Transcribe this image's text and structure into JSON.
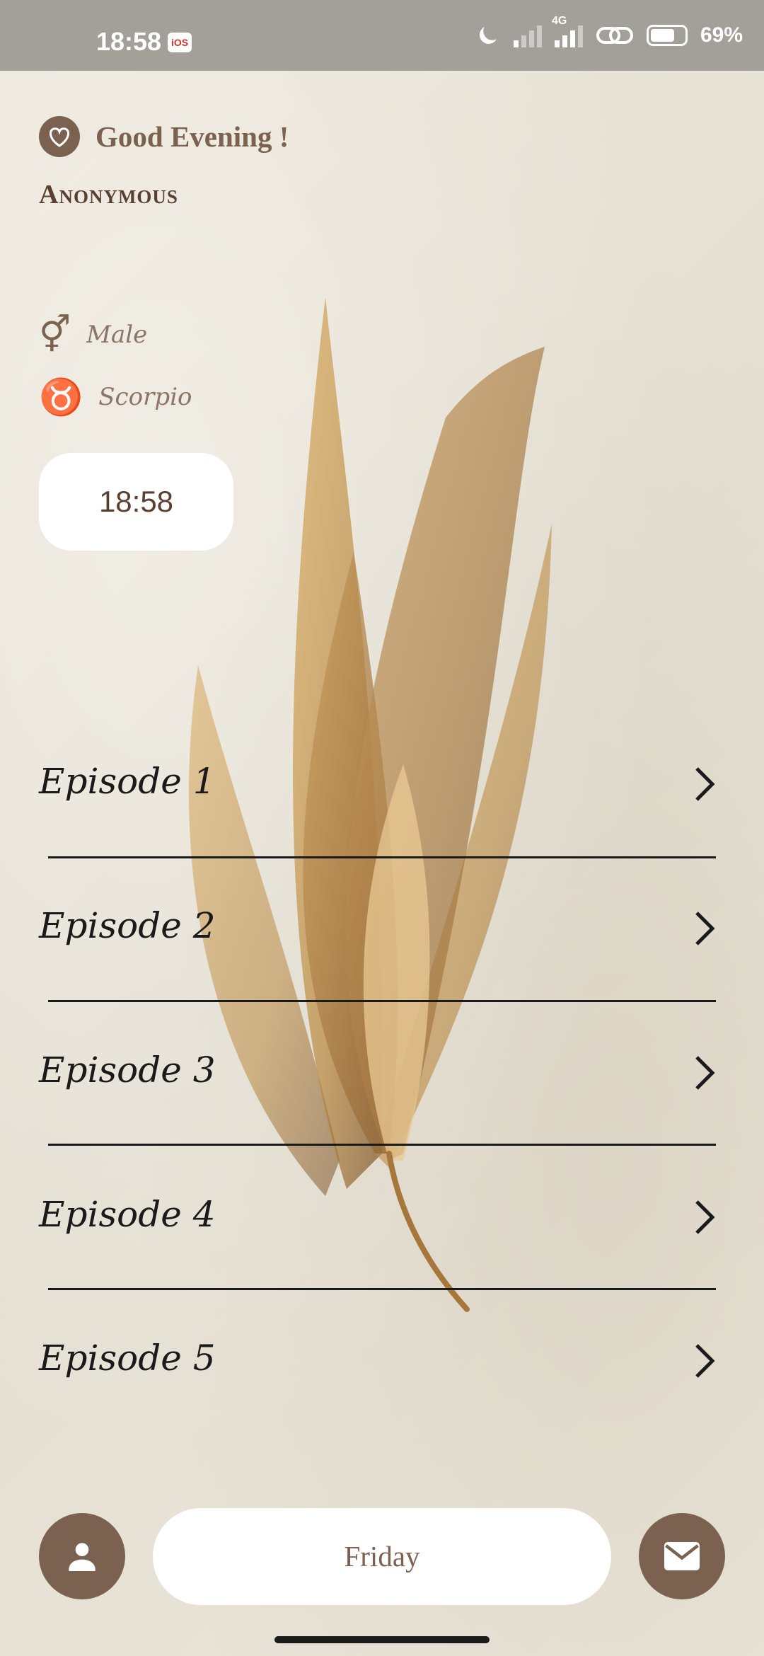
{
  "status_bar": {
    "time": "18:58",
    "badge": "iOS",
    "network": "4G",
    "battery": "69%"
  },
  "header": {
    "greeting": "Good Evening !",
    "username": "Anonymous"
  },
  "profile": {
    "gender": "Male",
    "zodiac": "Scorpio"
  },
  "clock": {
    "time": "18:58"
  },
  "episodes": [
    {
      "label": "Episode 1"
    },
    {
      "label": "Episode 2"
    },
    {
      "label": "Episode 3"
    },
    {
      "label": "Episode 4"
    },
    {
      "label": "Episode 5"
    }
  ],
  "bottom_bar": {
    "day": "Friday",
    "profile_icon": "person-icon",
    "mail_icon": "mail-icon"
  },
  "colors": {
    "accent": "#7b6250",
    "text_dark": "#1a1a1a",
    "background": "#ebe6da"
  }
}
